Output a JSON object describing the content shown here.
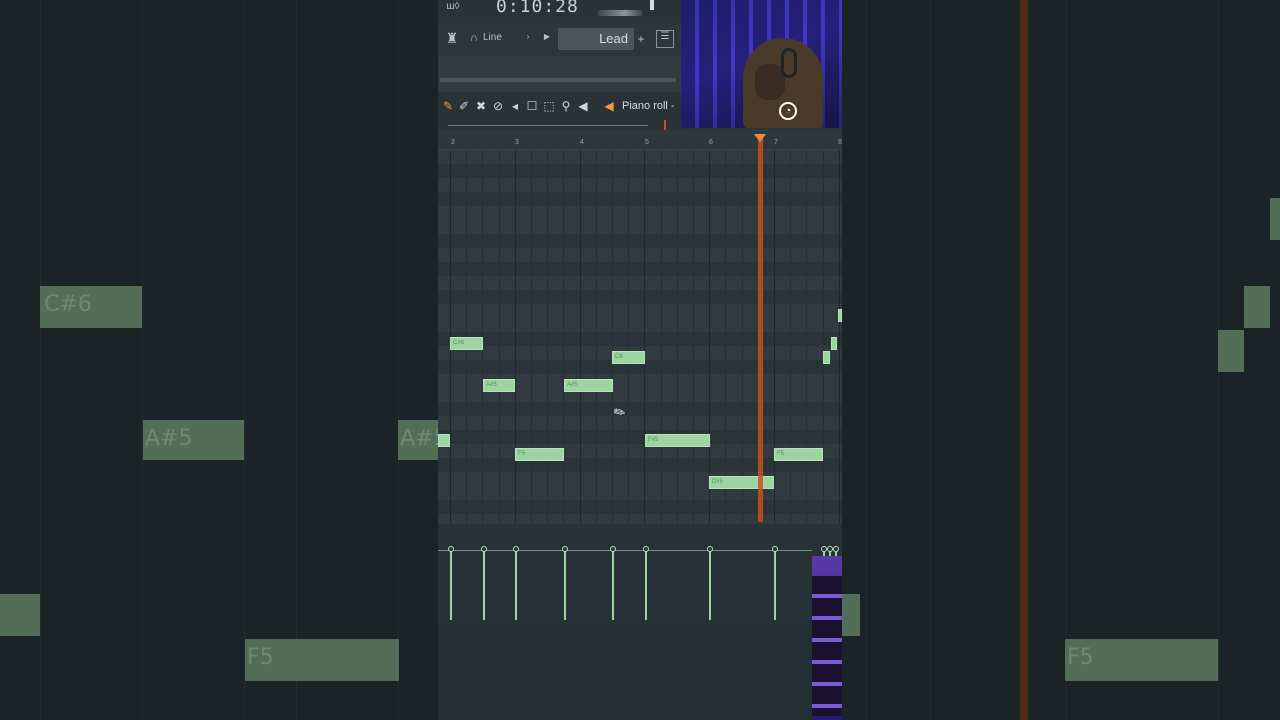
{
  "transport": {
    "time": "0:10:28"
  },
  "toolbar": {
    "tool_mode": "Line",
    "channel": "Lead",
    "add_button": "+"
  },
  "piano_roll": {
    "title": "Piano roll -",
    "ruler": [
      "2",
      "3",
      "4",
      "5",
      "6",
      "7",
      "8"
    ],
    "notes": [
      {
        "label": "C#6"
      },
      {
        "label": "A#5"
      },
      {
        "label": "A#5"
      },
      {
        "label": "C6"
      },
      {
        "label": "F5"
      },
      {
        "label": "F#5"
      },
      {
        "label": "D#5"
      },
      {
        "label": "F5"
      }
    ]
  },
  "background": {
    "notes": [
      "C#6",
      "A#5",
      "A#5",
      "F5",
      "F5"
    ]
  },
  "colors": {
    "note_fill": "#9ed4a2",
    "playhead": "#c6521d",
    "grid_bg": "#2f383c"
  },
  "icons": [
    "pencil-icon",
    "paint-icon",
    "delete-icon",
    "mute-icon",
    "slice-icon",
    "select-icon",
    "zoom-icon",
    "speaker-icon"
  ]
}
